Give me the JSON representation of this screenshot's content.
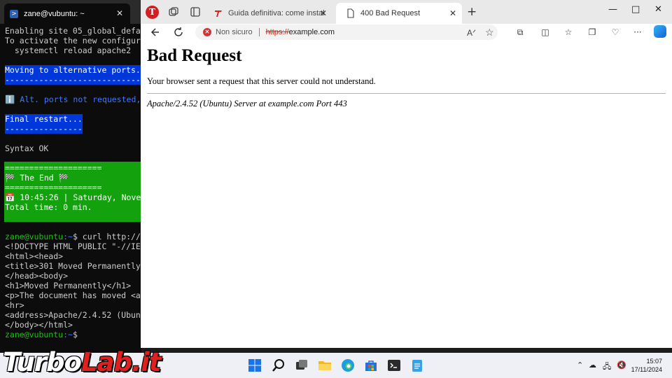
{
  "terminal": {
    "tab_title": "zane@vubuntu: ~",
    "lines": {
      "l1": "Enabling site 05_global_defa",
      "l2": "To activate the new configur",
      "l3": "  systemctl reload apache2",
      "l4": "Moving to alternative ports.",
      "l5": "----------------------------",
      "l6": "ℹ️ Alt. ports not requested,",
      "l7": "Final restart...",
      "l8": "----------------",
      "l9": "Syntax OK",
      "l10": "====================",
      "l11": "🏁 The End 🏁",
      "l12": "====================",
      "l13": "📅 10:45:26 | Saturday, Nove",
      "l14": "Total time: 0 min.",
      "prompt_user": "zane@vubuntu",
      "prompt_path": ":~",
      "cmd": "$ curl http://",
      "l16": "<!DOCTYPE HTML PUBLIC \"-//IE",
      "l17": "<html><head>",
      "l18": "<title>301 Moved Permanently",
      "l19": "</head><body>",
      "l20": "<h1>Moved Permanently</h1>",
      "l21": "<p>The document has moved <a",
      "l22": "<hr>",
      "l23": "<address>Apache/2.4.52 (Ubun",
      "l24": "</body></html>",
      "final_prompt_end": "$"
    }
  },
  "browser": {
    "profile_letter": "T",
    "tabs": [
      {
        "label": "Guida definitiva: come installare e",
        "active": false
      },
      {
        "label": "400 Bad Request",
        "active": true
      }
    ],
    "new_tab": "+",
    "window_controls": {
      "minimize": "—",
      "maximize": "□",
      "close": "✕"
    },
    "address": {
      "security_text": "Non sicuro",
      "url_scheme": "https://",
      "url_rest": "example.com"
    },
    "page": {
      "heading": "Bad Request",
      "message": "Your browser sent a request that this server could not understand.",
      "server_signature": "Apache/2.4.52 (Ubuntu) Server at example.com Port 443"
    }
  },
  "watermark": {
    "part1": "Turbo",
    "part2": "Lab.it"
  },
  "taskbar": {
    "time": "15:07",
    "date": "17/11/2024"
  },
  "colors": {
    "terminal_bg": "#0c0c0c",
    "highlight_blue": "#0037da",
    "highlight_green": "#13a10e",
    "insecure_red": "#d13438",
    "taskbar_bg": "#eef0f5"
  }
}
